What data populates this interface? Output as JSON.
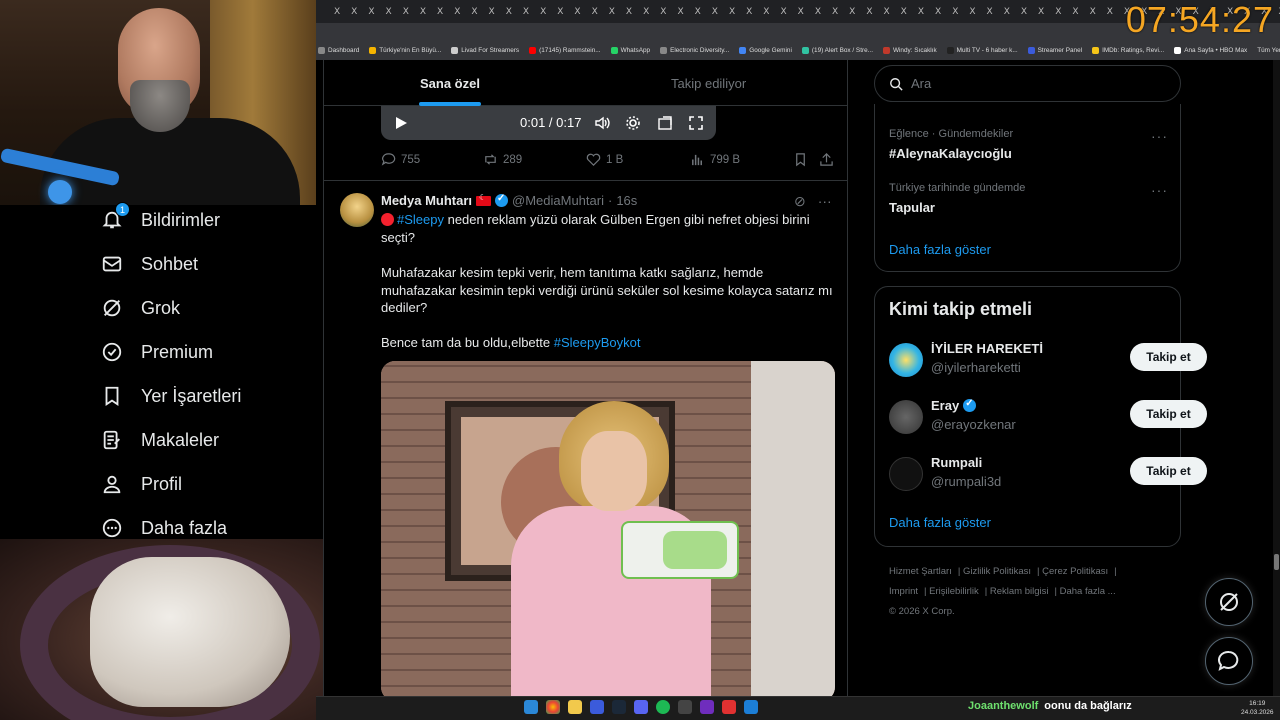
{
  "clock": "07:54:27",
  "browser": {
    "bookmarks": [
      {
        "label": "Dashboard",
        "color": "#888888"
      },
      {
        "label": "Türkiye'nin En Büyü...",
        "color": "#f5b400"
      },
      {
        "label": "Livad For Streamers",
        "color": "#cccccc"
      },
      {
        "label": "(17145) Rammstein...",
        "color": "#ff0000"
      },
      {
        "label": "WhatsApp",
        "color": "#25d366"
      },
      {
        "label": "Electronic Diversity...",
        "color": "#888888"
      },
      {
        "label": "Google Gemini",
        "color": "#4285f4"
      },
      {
        "label": "(19) Alert Box / Stre...",
        "color": "#31c3a2"
      },
      {
        "label": "Windy: Sıcaklık",
        "color": "#c0392b"
      },
      {
        "label": "Multi TV - 6 haber k...",
        "color": "#222222"
      },
      {
        "label": "Streamer Panel",
        "color": "#3b5bdb"
      },
      {
        "label": "IMDb: Ratings, Revi...",
        "color": "#f5c518"
      },
      {
        "label": "Ana Sayfa • HBO Max",
        "color": "#ffffff"
      }
    ],
    "all_bookmarks": "Tüm Yer İşaretleri"
  },
  "nav": {
    "items": [
      {
        "label": "Bildirimler",
        "icon": "bell-icon",
        "badge": "1"
      },
      {
        "label": "Sohbet",
        "icon": "mail-icon"
      },
      {
        "label": "Grok",
        "icon": "grok-icon"
      },
      {
        "label": "Premium",
        "icon": "premium-icon"
      },
      {
        "label": "Yer İşaretleri",
        "icon": "bookmark-icon"
      },
      {
        "label": "Makaleler",
        "icon": "article-icon"
      },
      {
        "label": "Profil",
        "icon": "profile-icon"
      },
      {
        "label": "Daha fazla",
        "icon": "more-icon"
      }
    ]
  },
  "timeline": {
    "tabs": {
      "for_you": "Sana özel",
      "following": "Takip ediliyor"
    },
    "video": {
      "time": "0:01 / 0:17"
    },
    "prev_actions": {
      "replies": "755",
      "reposts": "289",
      "likes": "1 B",
      "views": "799 B"
    },
    "post": {
      "name": "Medya Muhtarı",
      "handle": "@MediaMuhtari",
      "age": "16s",
      "p1_hash": "#Sleepy",
      "p1_text": " neden reklam yüzü olarak Gülben Ergen gibi nefret objesi birini seçti?",
      "p2_text": " Muhafazakar kesim tepki verir, hem tanıtıma katkı sağlarız, hemde muhafazakar kesimin tepki verdiği ürünü seküler sol kesime kolayca satarız mı dediler?",
      "p3_text": "Bence tam da bu oldu,elbette ",
      "p3_hash": "#SleepyBoykot"
    }
  },
  "right": {
    "search_placeholder": "Ara",
    "trends": [
      {
        "context": "Eğlence · Gündemdekiler",
        "title": "#AleynaKalaycıoğlu"
      },
      {
        "context": "Türkiye tarihinde gündemde",
        "title": "Tapular"
      }
    ],
    "show_more": "Daha fazla göster",
    "who_to_follow": "Kimi takip etmeli",
    "accounts": [
      {
        "name": "İYİLER HAREKETİ",
        "handle": "@iyilerhareketti",
        "verified": false
      },
      {
        "name": "Eray",
        "handle": "@erayozkenar",
        "verified": true
      },
      {
        "name": "Rumpali",
        "handle": "@rumpali3d",
        "verified": false
      }
    ],
    "follow_label": "Takip et",
    "show_more_2": "Daha fazla göster",
    "footer_links": [
      "Hizmet Şartları",
      "Gizlilik Politikası",
      "Çerez Politikası",
      "Imprint",
      "Erişilebilirlik",
      "Reklam bilgisi",
      "Daha fazla ..."
    ],
    "copyright": "© 2026 X Corp."
  },
  "stream_chat": {
    "user": "Joaanthewolf",
    "message": "oonu da bağlarız"
  },
  "taskbar": {
    "time": "16:19",
    "date": "24.03.2026"
  }
}
